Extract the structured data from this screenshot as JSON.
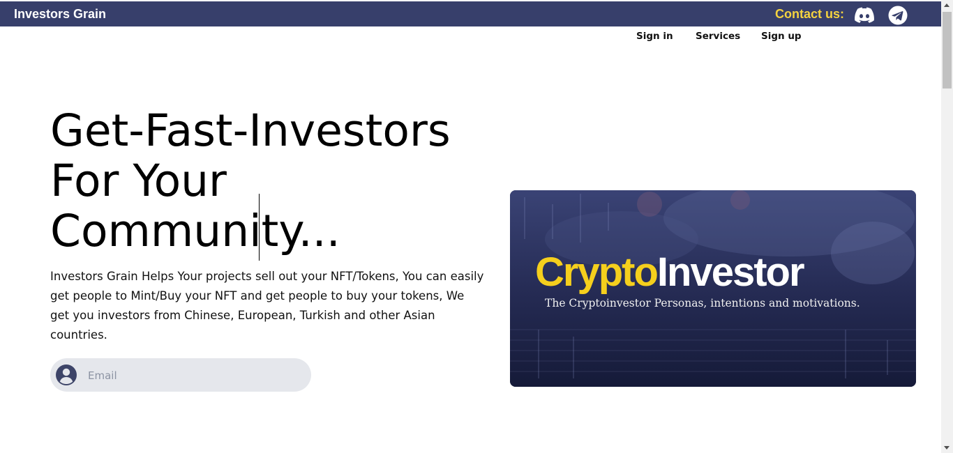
{
  "header": {
    "brand": "Investors Grain",
    "contact_label": "Contact us:",
    "icons": [
      "discord-icon",
      "telegram-icon"
    ],
    "colors": {
      "bar": "#373f6b",
      "contact": "#f5d33f"
    }
  },
  "nav": {
    "items": [
      {
        "label": "Sign in"
      },
      {
        "label": "Services"
      },
      {
        "label": "Sign up"
      }
    ]
  },
  "hero": {
    "title_lines": [
      "Get-Fast-Investors",
      "For Your",
      "Community..."
    ],
    "description": "Investors Grain Helps Your projects sell out your NFT/Tokens, You can easily get people to Mint/Buy your NFT and get people to buy your tokens, We get you investors from Chinese, European, Turkish and other Asian countries.",
    "email_placeholder": "Email",
    "email_value": ""
  },
  "banner": {
    "title_part1": "Crypto",
    "title_part2": "Investor",
    "subtitle": "The Cryptoinvestor Personas, intentions and motivations."
  }
}
